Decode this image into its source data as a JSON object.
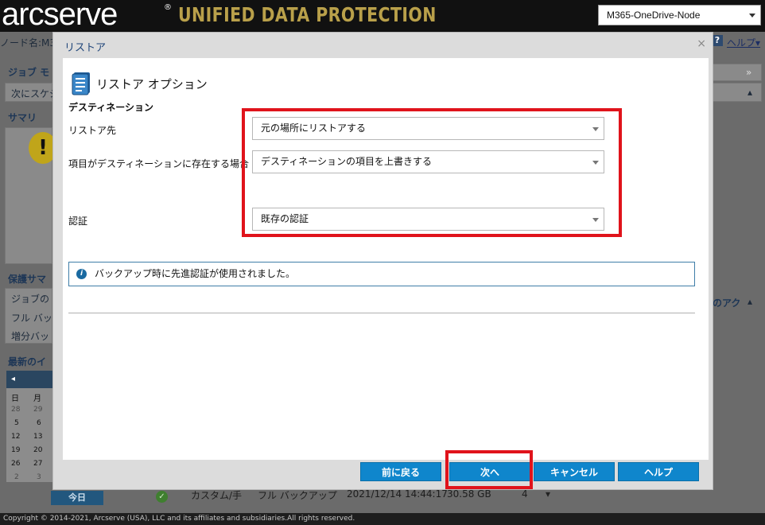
{
  "header": {
    "logo_main": "arcserve",
    "logo_reg": "®",
    "logo_product": "UNIFIED DATA PROTECTION",
    "node_select_value": "M365-OneDrive-Node"
  },
  "background": {
    "node_label": "ノード名:",
    "node_value": "M3",
    "help_icon": "?",
    "help_label": "ヘルプ",
    "job_monitor": "ジョブ モ",
    "next_schedule": "次にスケジ",
    "summary": "サマリ",
    "protection_summary": "保護サマ",
    "job_row_1": "ジョブの",
    "job_row_2": "フル バッ",
    "job_row_3": "増分バッ",
    "latest_events": "最新のイ",
    "right_action": "のアク",
    "calendar": {
      "weekdays": [
        "日",
        "月"
      ],
      "rows": [
        [
          "28",
          "29"
        ],
        [
          "5",
          "6"
        ],
        [
          "12",
          "13"
        ],
        [
          "19",
          "20"
        ],
        [
          "26",
          "27"
        ],
        [
          "2",
          "3"
        ]
      ]
    },
    "today_label": "今日",
    "bottom_row": {
      "type": "カスタム/手",
      "backup_type": "フル バックアップ",
      "datetime": "2021/12/14 14:44:17",
      "size": "30.58 GB",
      "extra": "4"
    },
    "footer": "Copyright © 2014-2021, Arcserve (USA), LLC and its affiliates and subsidiaries.All rights reserved."
  },
  "dialog": {
    "title": "リストア",
    "close_symbol": "×",
    "section_title": "リストア オプション",
    "destination_heading": "デスティネーション",
    "fields": {
      "restore_to_label": "リストア先",
      "restore_to_value": "元の場所にリストアする",
      "if_exists_label": "項目がデスティネーションに存在する場合",
      "if_exists_value": "デスティネーションの項目を上書きする",
      "auth_label": "認証",
      "auth_value": "既存の認証"
    },
    "info_message": "バックアップ時に先進認証が使用されました。",
    "buttons": {
      "back": "前に戻る",
      "next": "次へ",
      "cancel": "キャンセル",
      "help": "ヘルプ"
    }
  },
  "colors": {
    "highlight_red": "#e0131b",
    "button_blue": "#0f86cc",
    "title_blue": "#20467a"
  }
}
